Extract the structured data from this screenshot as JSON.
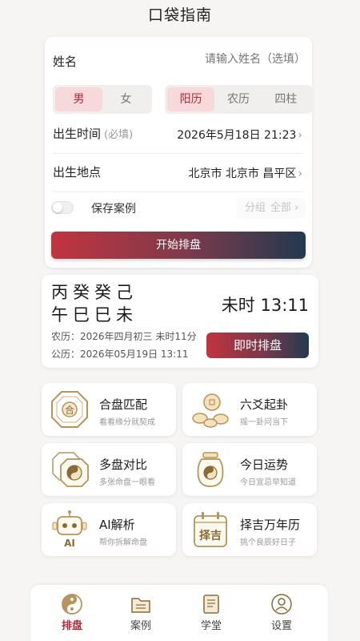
{
  "header": {
    "title": "口袋指南"
  },
  "form": {
    "name_label": "姓名",
    "name_placeholder": "请输入姓名（选填）",
    "gender": {
      "options": [
        "男",
        "女"
      ],
      "selected": "男"
    },
    "calendar": {
      "options": [
        "阳历",
        "农历",
        "四柱"
      ],
      "selected": "阳历"
    },
    "birth_time_label": "出生时间",
    "birth_time_required": "(必填)",
    "birth_time_value": "2026年5月18日 21:23",
    "birth_place_label": "出生地点",
    "birth_place_value": "北京市 北京市 昌平区",
    "save_case_label": "保存案例",
    "save_case_on": false,
    "group_label": "分组",
    "group_value": "全部",
    "chevron": "›",
    "start_button": "开始排盘"
  },
  "pillars": {
    "stems": "丙癸癸己",
    "branches": "午巳巳未",
    "current_time": "未时 13:11",
    "lunar": "农历：2026年四月初三 未时11分",
    "solar": "公历：2026年05月19日 13:11",
    "instant_button": "即时排盘"
  },
  "features": [
    {
      "title": "合盘匹配",
      "subtitle": "看看缘分就契成",
      "icon": "bagua-he-icon"
    },
    {
      "title": "六爻起卦",
      "subtitle": "摇一卦问当下",
      "icon": "coins-icon"
    },
    {
      "title": "多盘对比",
      "subtitle": "多张命盘一眼看",
      "icon": "taiji-compare-icon"
    },
    {
      "title": "今日运势",
      "subtitle": "今日宜忌早知道",
      "icon": "jar-icon"
    },
    {
      "title": "AI解析",
      "subtitle": "帮你拆解命盘",
      "icon": "ai-robot-icon"
    },
    {
      "title": "择吉万年历",
      "subtitle": "挑个良辰好日子",
      "icon": "calendar-zeji-icon"
    }
  ],
  "tile_icon_text": {
    "he": "合",
    "ai": "AI",
    "zeji": "择吉"
  },
  "nav": [
    {
      "label": "排盘",
      "icon": "taiji-icon",
      "active": true
    },
    {
      "label": "案例",
      "icon": "folder-icon",
      "active": false
    },
    {
      "label": "学堂",
      "icon": "book-icon",
      "active": false
    },
    {
      "label": "设置",
      "icon": "user-icon",
      "active": false
    }
  ],
  "colors": {
    "accent": "#b0283a",
    "gold": "#b8935a",
    "navy": "#22394f"
  }
}
